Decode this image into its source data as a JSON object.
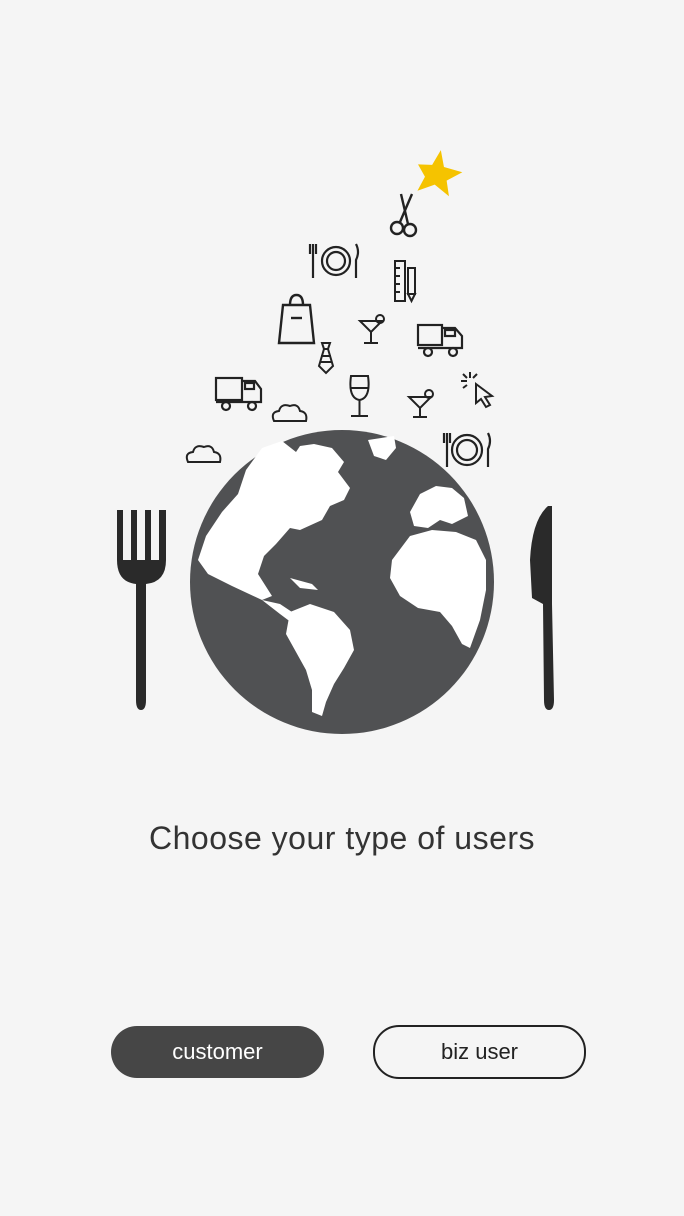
{
  "prompt": {
    "text": "Choose your type of users"
  },
  "buttons": {
    "customer_label": "customer",
    "biz_user_label": "biz user"
  },
  "colors": {
    "background": "#f5f5f5",
    "globe_ocean": "#505153",
    "land": "#ffffff",
    "utensils": "#2a2a2a",
    "star": "#f5c300",
    "primary_button": "#464646"
  },
  "icons": [
    "star-icon",
    "scissors-icon",
    "plate-icon",
    "ruler-pencil-icon",
    "shopping-bag-icon",
    "cocktail-icon",
    "delivery-truck-icon",
    "necktie-icon",
    "truck-icon",
    "cloud-icon",
    "wine-glass-icon",
    "cocktail-icon",
    "cursor-click-icon",
    "plate-icon",
    "cloud-icon",
    "globe-icon",
    "fork-icon",
    "knife-icon"
  ]
}
